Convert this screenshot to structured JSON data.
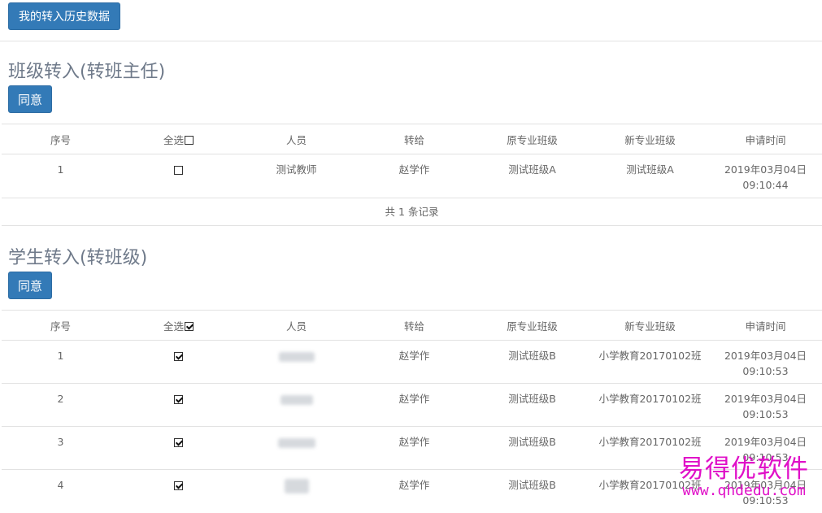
{
  "toolbar": {
    "history_label": "我的转入历史数据"
  },
  "section1": {
    "title": "班级转入(转班主任)",
    "agree_label": "同意",
    "columns": [
      "序号",
      "全选",
      "人员",
      "转给",
      "原专业班级",
      "新专业班级",
      "申请时间"
    ],
    "select_all_checked": false,
    "rows": [
      {
        "index": "1",
        "checked": false,
        "person": "测试教师",
        "transfer_to": "赵学作",
        "old_class": "测试班级A",
        "new_class": "测试班级A",
        "date": "2019年03月04日",
        "time": "09:10:44"
      }
    ],
    "summary": "共 1 条记录"
  },
  "section2": {
    "title": "学生转入(转班级)",
    "agree_label": "同意",
    "columns": [
      "序号",
      "全选",
      "人员",
      "转给",
      "原专业班级",
      "新专业班级",
      "申请时间"
    ],
    "select_all_checked": true,
    "rows": [
      {
        "index": "1",
        "checked": true,
        "person": "",
        "transfer_to": "赵学作",
        "old_class": "测试班级B",
        "new_class": "小学教育20170102班",
        "date": "2019年03月04日",
        "time": "09:10:53"
      },
      {
        "index": "2",
        "checked": true,
        "person": "",
        "transfer_to": "赵学作",
        "old_class": "测试班级B",
        "new_class": "小学教育20170102班",
        "date": "2019年03月04日",
        "time": "09:10:53"
      },
      {
        "index": "3",
        "checked": true,
        "person": "",
        "transfer_to": "赵学作",
        "old_class": "测试班级B",
        "new_class": "小学教育20170102班",
        "date": "2019年03月04日",
        "time": "09:10:53"
      },
      {
        "index": "4",
        "checked": true,
        "person": "",
        "transfer_to": "赵学作",
        "old_class": "测试班级B",
        "new_class": "小学教育20170102班",
        "date": "2019年03月04日",
        "time": "09:10:53"
      }
    ]
  },
  "watermark": {
    "line1": "易得优软件",
    "line2": "www.qhdedu.com"
  },
  "colors": {
    "primary_button": "#337ab7",
    "watermark": "#e010c8",
    "title": "#6f7a8a"
  }
}
